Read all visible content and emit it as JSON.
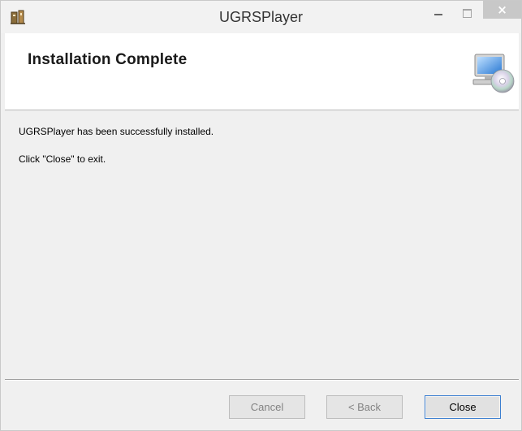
{
  "window": {
    "title": "UGRSPlayer"
  },
  "banner": {
    "heading": "Installation Complete",
    "icon": "computer-cd-icon"
  },
  "content": {
    "message_1": "UGRSPlayer has been successfully installed.",
    "message_2": "Click \"Close\" to exit."
  },
  "buttons": {
    "cancel": "Cancel",
    "back": "< Back",
    "close": "Close"
  },
  "titlebar_controls": {
    "close_glyph": "×"
  },
  "colors": {
    "accent": "#3c7fd0",
    "disabled_text": "#838383"
  }
}
